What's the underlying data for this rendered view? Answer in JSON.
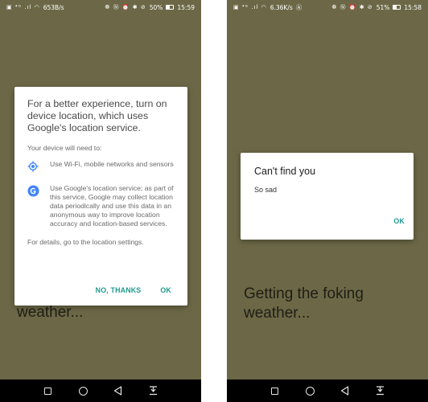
{
  "theme": {
    "background": "#6c6847",
    "accent": "#1f9a8f",
    "nav_bar": "#000000"
  },
  "left_phone": {
    "status_bar": {
      "signal_icons": "▣ ⁴ᴳ .ıl ◠",
      "speed": "653B/s",
      "right_icons": "❁ Ⓝ ⏰ ✱ ⊘",
      "battery": "50%",
      "battery_level": 0.5,
      "time": "15:59"
    },
    "background_text": "weather...",
    "dialog": {
      "title": "For a better experience, turn on device location, which uses Google's location service.",
      "subtitle": "Your device will need to:",
      "items": [
        {
          "icon": "location-target-icon",
          "text": "Use Wi-Fi, mobile networks and sensors"
        },
        {
          "icon": "google-g-icon",
          "text": "Use Google's location service; as part of this service, Google may collect location data periodically and use this data in an anonymous way to improve location accuracy and location-based services."
        }
      ],
      "footer": "For details, go to the location settings.",
      "negative_label": "NO, THANKS",
      "positive_label": "OK"
    },
    "nav": [
      "square-icon",
      "circle-icon",
      "back-triangle-icon",
      "notification-pull-icon"
    ]
  },
  "right_phone": {
    "status_bar": {
      "signal_icons": "▣ ⁴ᴳ .ıl ◠",
      "speed": "6.36K/s",
      "extra_icon": "Ⓐ",
      "right_icons": "❁ Ⓝ ⏰ ✱ ⊘",
      "battery": "51%",
      "battery_level": 0.51,
      "time": "15:58"
    },
    "background_text_line1": "Getting the foking",
    "background_text_line2": "weather...",
    "dialog": {
      "title": "Can't find you",
      "message": "So sad",
      "positive_label": "OK"
    }
  }
}
